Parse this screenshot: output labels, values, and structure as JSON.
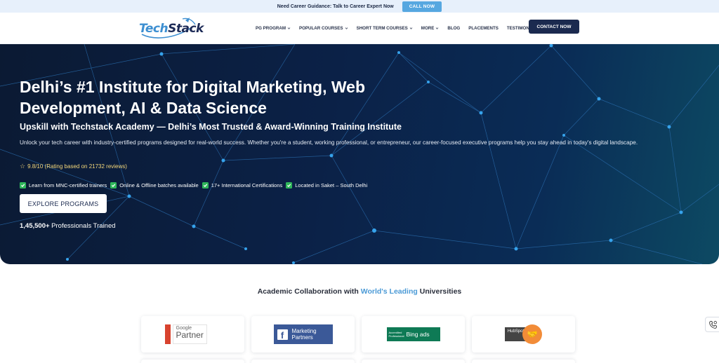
{
  "topbar": {
    "text": "Need Career Guidance: Talk to Career Expert Now",
    "call_label": "CALL NOW"
  },
  "header": {
    "logo_text_a": "Tech",
    "logo_text_b": "Stack",
    "nav": [
      {
        "label": "PG PROGRAM",
        "dropdown": true
      },
      {
        "label": "POPULAR COURSES",
        "dropdown": true
      },
      {
        "label": "SHORT TERM COURSES",
        "dropdown": true
      },
      {
        "label": "MORE",
        "dropdown": true
      },
      {
        "label": "BLOG",
        "dropdown": false
      },
      {
        "label": "PLACEMENTS",
        "dropdown": false
      },
      {
        "label": "TESTIMONIALS",
        "dropdown": false
      }
    ],
    "contact_label": "CONTACT NOW"
  },
  "hero": {
    "title": "Delhi’s #1 Institute for Digital Marketing, Web Development, AI & Data Science",
    "subtitle": "Upskill with Techstack Academy — Delhi’s Most Trusted & Award-Winning Training Institute",
    "description": "Unlock your tech career with industry-certified programs designed for real-world success. Whether you're a student, working professional, or entrepreneur, our career-focused executive programs help you stay ahead in today's digital landscape.",
    "rating": "9.8/10 (Rating based on 21732 reviews)",
    "features": [
      "Learn from MNC-certified trainers",
      "Online & Offline batches available",
      "17+ International Certifications",
      "Located in Saket – South Delhi"
    ],
    "explore_label": "EXPLORE PROGRAMS",
    "trained_count": "1,45,500+",
    "trained_label": "Professionals Trained"
  },
  "academic": {
    "title_pre": "Academic Collaboration with ",
    "title_highlight": "World's Leading",
    "title_post": " Universities",
    "partners": [
      {
        "small": "Google",
        "big": "Partner"
      },
      {
        "line1": "Marketing",
        "line2": "Partners"
      },
      {
        "small": "Accredited Professional",
        "big": "Bing ads"
      },
      {
        "text": "HubSpot"
      }
    ]
  },
  "colors": {
    "accent": "#56a7e0",
    "navy": "#1b2a4f",
    "highlight": "#4b9ad6",
    "check_green": "#2fb65a"
  }
}
